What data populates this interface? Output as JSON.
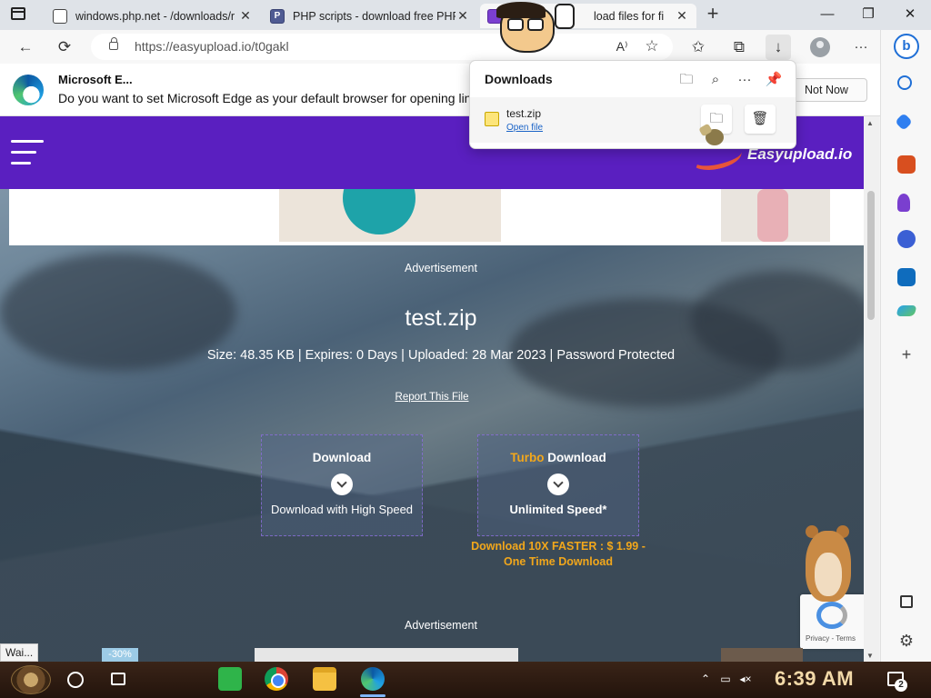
{
  "browser": {
    "tabs": [
      {
        "label": "windows.php.net - /downloads/r",
        "icon": "page-icon"
      },
      {
        "label": "PHP scripts - download free PHP",
        "icon": "php-icon"
      },
      {
        "label": "load files for fi",
        "icon": "easyupload-icon"
      }
    ],
    "new_tab_symbol": "+",
    "window_controls": {
      "minimize": "—",
      "maximize": "❐",
      "close": "✕"
    },
    "tab_close_symbol": "✕",
    "url": "https://easyupload.io/t0gakl"
  },
  "toolbar": {
    "back": "←",
    "refresh": "⟳",
    "read_aloud": "A⁾",
    "add_favorite": "☆",
    "favorites": "✩",
    "collections": "⧉",
    "downloads": "↓",
    "more": "···"
  },
  "banner": {
    "title": "Microsoft E...",
    "text": "Do you want to set Microsoft Edge as your default browser for opening links",
    "not_now": "Not Now"
  },
  "downloads_panel": {
    "title": "Downloads",
    "icons": {
      "folder": "🗀",
      "search": "⌕",
      "more": "···",
      "pin": "📌"
    },
    "item": {
      "name": "test.zip",
      "open_link": "Open file",
      "open_folder_icon": "🗀",
      "delete_icon": "🗑"
    }
  },
  "page": {
    "site_name": "Easyupload.io",
    "advertisement_top": "Advertisement",
    "file_name": "test.zip",
    "file_meta": "Size: 48.35 KB | Expires: 0 Days | Uploaded: 28 Mar 2023 | Password Protected",
    "report": "Report This File",
    "download": {
      "title": "Download",
      "subtitle": "Download with High Speed"
    },
    "turbo": {
      "title_accent": "Turbo",
      "title_rest": " Download",
      "subtitle": "Unlimited Speed*"
    },
    "turbo_promo_line1": "Download 10X FASTER : $ 1.99 -",
    "turbo_promo_line2": "One Time Download",
    "advertisement_bottom": "Advertisement",
    "discount_badge": "-30%",
    "recaptcha_text": "Privacy - Terms"
  },
  "status_text": "Wai...",
  "sidebar": {
    "bing": "b",
    "add": "+"
  },
  "taskbar": {
    "clock": "6:39 AM",
    "notification_count": "2"
  }
}
